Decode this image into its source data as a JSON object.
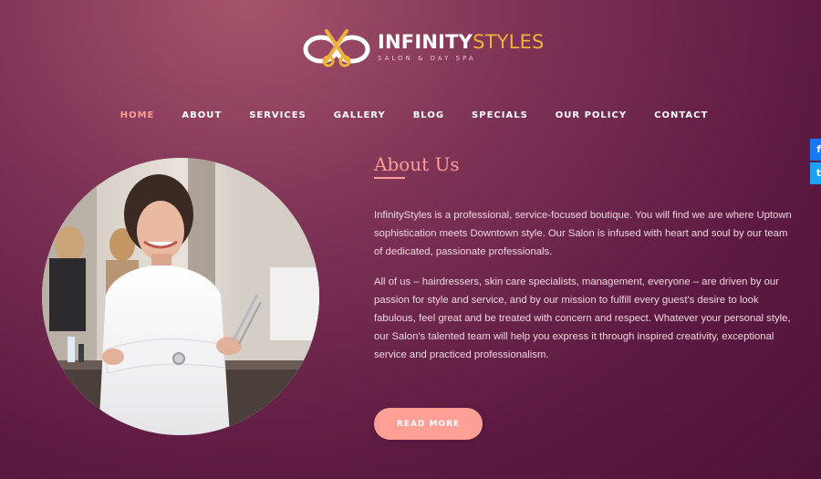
{
  "header": {
    "brand_primary": "INFINITY",
    "brand_secondary": "STYLES",
    "tagline": "SALON & DAY SPA"
  },
  "nav": {
    "items": [
      {
        "label": "HOME",
        "active": true
      },
      {
        "label": "ABOUT",
        "active": false
      },
      {
        "label": "SERVICES",
        "active": false
      },
      {
        "label": "GALLERY",
        "active": false
      },
      {
        "label": "BLOG",
        "active": false
      },
      {
        "label": "SPECIALS",
        "active": false
      },
      {
        "label": "OUR POLICY",
        "active": false
      },
      {
        "label": "CONTACT",
        "active": false
      }
    ]
  },
  "social": {
    "facebook_glyph": "f",
    "twitter_glyph": "t"
  },
  "about": {
    "title": "About Us",
    "paragraphs": [
      "InfinityStyles is a professional, service-focused boutique. You will find we are where Uptown sophistication meets Downtown style. Our Salon is infused with heart and soul by our team of dedicated, passionate professionals.",
      "All of us – hairdressers, skin care specialists, management, everyone – are driven by our passion for style and service, and by our mission to fulfill every guest's desire to look fabulous, feel great and be treated with concern and respect. Whatever your personal style, our Salon's talented team will help you express it through inspired creativity, exceptional service and practiced professionalism."
    ],
    "button_label": "READ MORE"
  },
  "colors": {
    "accent": "#ff9e96",
    "brand_gold": "#f0b13b",
    "background_dark": "#5d1a42"
  },
  "icons": {
    "logo": "infinity-scissors-logo",
    "facebook": "facebook-icon",
    "twitter": "twitter-icon"
  }
}
